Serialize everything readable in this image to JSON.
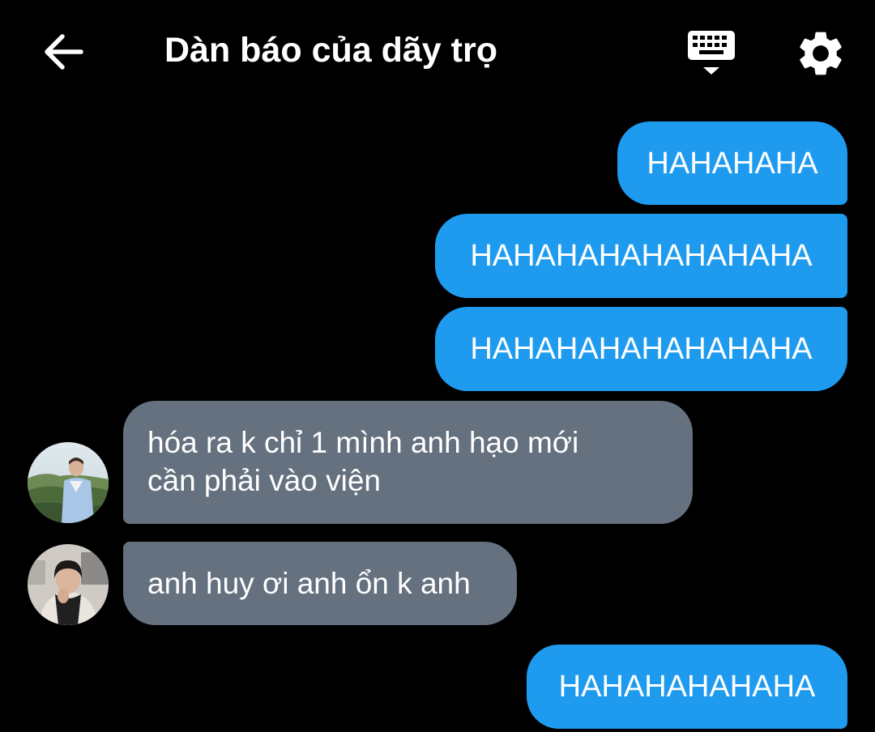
{
  "header": {
    "title": "Dàn báo của dãy trọ",
    "back_icon": "arrow-left-icon",
    "keyboard_icon": "keyboard-icon",
    "settings_icon": "gear-icon"
  },
  "colors": {
    "background": "#000000",
    "outgoing_bubble": "#1e9bef",
    "incoming_bubble": "#65717f",
    "text": "#ffffff"
  },
  "messages": [
    {
      "direction": "outgoing",
      "text": "HAHAHAHA"
    },
    {
      "direction": "outgoing",
      "text": "HAHAHAHAHAHAHAHA"
    },
    {
      "direction": "outgoing",
      "text": "HAHAHAHAHAHAHAHA"
    },
    {
      "direction": "incoming",
      "lines": [
        "hóa ra k chỉ 1 mình anh hạo mới",
        "cần phải vào viện"
      ]
    },
    {
      "direction": "incoming",
      "text": "anh huy ơi anh ổn k anh"
    },
    {
      "direction": "outgoing",
      "text": "HAHAHAHAHAHA"
    }
  ]
}
